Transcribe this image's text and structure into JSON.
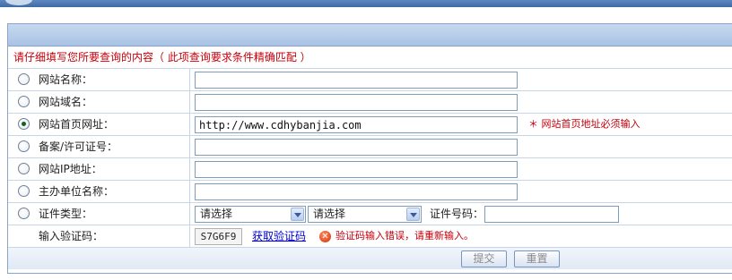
{
  "notice": "请仔细填写您所要查询的内容（ 此项查询要求条件精确匹配 ）",
  "fields": [
    {
      "label": "网站名称：",
      "value": "",
      "checked": false
    },
    {
      "label": "网站域名：",
      "value": "",
      "checked": false
    },
    {
      "label": "网站首页网址：",
      "value": "http://www.cdhybanjia.com",
      "checked": true,
      "note": "＊ 网站首页地址必须输入"
    },
    {
      "label": "备案/许可证号：",
      "value": "",
      "checked": false
    },
    {
      "label": "网站IP地址：",
      "value": "",
      "checked": false
    },
    {
      "label": "主办单位名称：",
      "value": "",
      "checked": false
    }
  ],
  "cert": {
    "label": "证件类型：",
    "select1": "请选择",
    "select2": "请选择",
    "number_label": "证件号码：",
    "number_value": ""
  },
  "verify": {
    "label": "输入验证码：",
    "code": "S7G6F9",
    "link": "获取验证码",
    "error": "验证码输入错误，请重新输入。"
  },
  "buttons": {
    "submit": "提交",
    "reset": "重置"
  },
  "colors": {
    "error": "#c4000b",
    "link": "#0000cc",
    "border": "#8ba5c8",
    "header": "#a9c2e4"
  }
}
